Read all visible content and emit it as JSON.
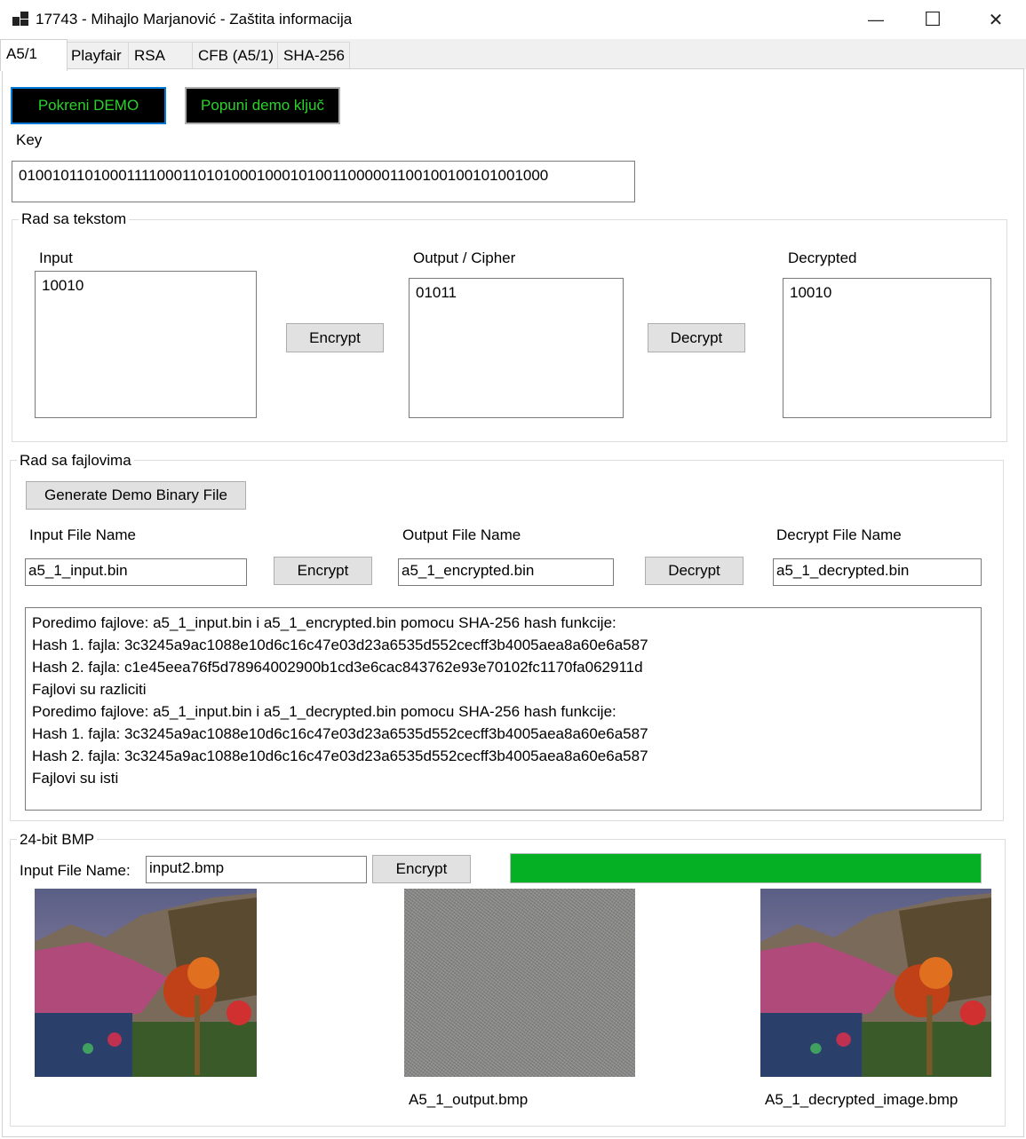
{
  "window": {
    "title": "17743 - Mihajlo Marjanović - Zaštita informacija",
    "minimize_glyph": "—",
    "maximize_glyph": "☐",
    "close_glyph": "✕"
  },
  "tabs": [
    {
      "label": "A5/1",
      "active": true
    },
    {
      "label": "Playfair",
      "active": false
    },
    {
      "label": "RSA",
      "active": false
    },
    {
      "label": "CFB (A5/1)",
      "active": false
    },
    {
      "label": "SHA-256",
      "active": false
    }
  ],
  "top_buttons": {
    "demo": "Pokreni DEMO",
    "fill_key": "Popuni demo ključ"
  },
  "key": {
    "label": "Key",
    "value": "0100101101000111100011010100010001010011000001100100100101001000"
  },
  "text_group": {
    "title": "Rad sa tekstom",
    "input_label": "Input",
    "input_value": "10010",
    "encrypt_button": "Encrypt",
    "output_label": "Output / Cipher",
    "output_value": "01011",
    "decrypt_button": "Decrypt",
    "decrypted_label": "Decrypted",
    "decrypted_value": "10010"
  },
  "file_group": {
    "title": "Rad sa fajlovima",
    "generate_button": "Generate Demo Binary File",
    "input_label": "Input File Name",
    "input_value": "a5_1_input.bin",
    "encrypt_button": "Encrypt",
    "output_label": "Output File Name",
    "output_value": "a5_1_encrypted.bin",
    "decrypt_button": "Decrypt",
    "decrypt_label": "Decrypt File Name",
    "decrypt_value": "a5_1_decrypted.bin",
    "log_lines": [
      "Poredimo fajlove: a5_1_input.bin i a5_1_encrypted.bin pomocu SHA-256 hash funkcije:",
      "Hash 1. fajla: 3c3245a9ac1088e10d6c16c47e03d23a6535d552cecff3b4005aea8a60e6a587",
      "Hash 2. fajla: c1e45eea76f5d78964002900b1cd3e6cac843762e93e70102fc1170fa062911d",
      "Fajlovi su razliciti",
      "Poredimo fajlove: a5_1_input.bin i a5_1_decrypted.bin pomocu SHA-256 hash funkcije:",
      "Hash 1. fajla: 3c3245a9ac1088e10d6c16c47e03d23a6535d552cecff3b4005aea8a60e6a587",
      "Hash 2. fajla: 3c3245a9ac1088e10d6c16c47e03d23a6535d552cecff3b4005aea8a60e6a587",
      "Fajlovi su isti"
    ]
  },
  "bmp_group": {
    "title": "24-bit BMP",
    "input_label": "Input File Name:",
    "input_value": "input2.bmp",
    "encrypt_button": "Encrypt",
    "progress_fraction": 1.0,
    "progress_color": "#06b025",
    "output_caption": "A5_1_output.bmp",
    "decrypted_caption": "A5_1_decrypted_image.bmp"
  }
}
